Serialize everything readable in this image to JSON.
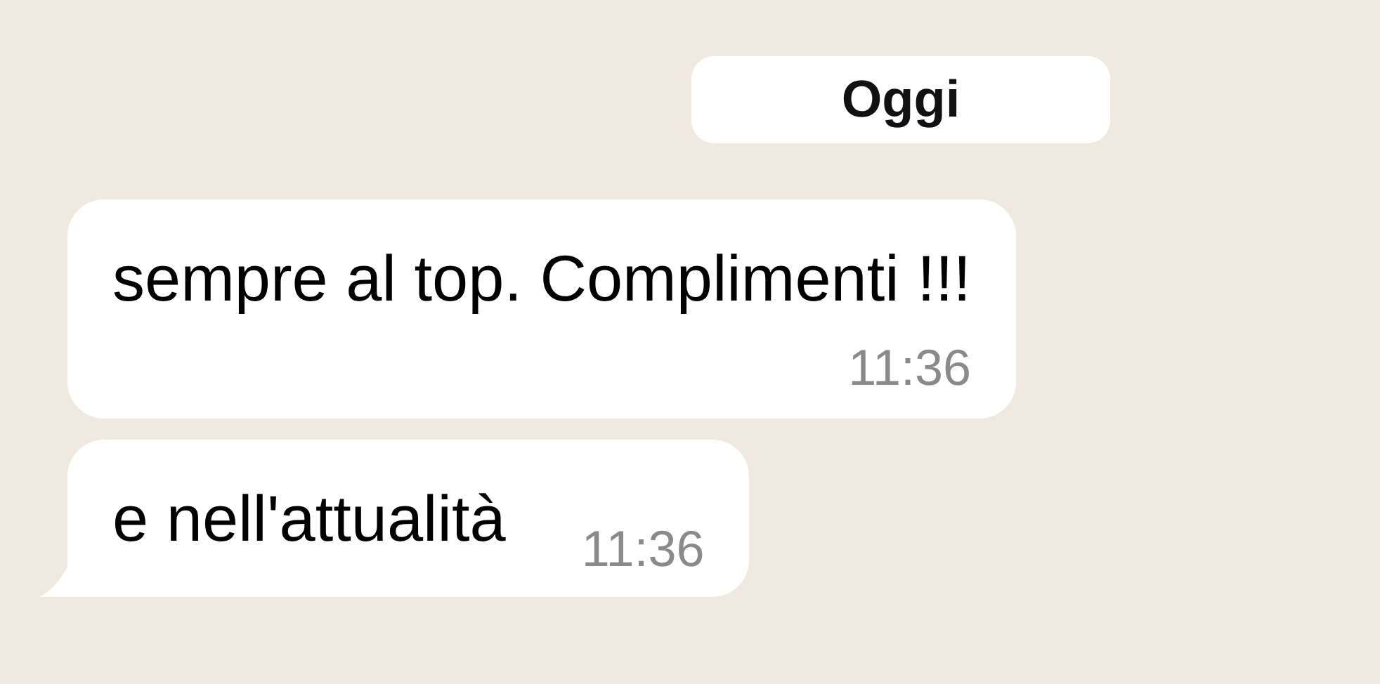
{
  "date_label": "Oggi",
  "messages": [
    {
      "kind": "stacked",
      "text": "sempre al top. Complimenti !!!",
      "time": "11:36",
      "tail": false
    },
    {
      "kind": "inline",
      "text": "e nell'attualità",
      "time": "11:36",
      "tail": true
    }
  ]
}
